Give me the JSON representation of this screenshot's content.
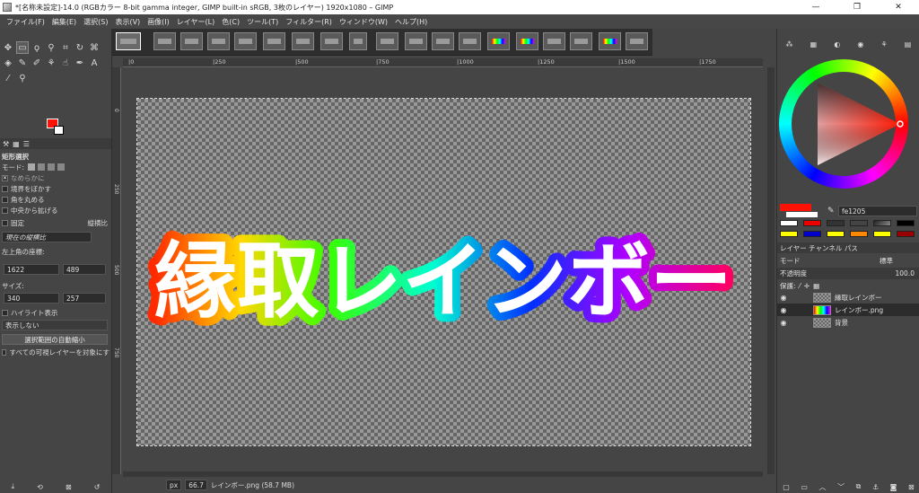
{
  "window": {
    "title": "*[名称未設定]-14.0 (RGBカラー 8-bit gamma integer, GIMP built-in sRGB, 3枚のレイヤー) 1920x1080 – GIMP",
    "minimize": "—",
    "maximize": "❐",
    "close": "✕"
  },
  "menu": [
    "ファイル(F)",
    "編集(E)",
    "選択(S)",
    "表示(V)",
    "画像(I)",
    "レイヤー(L)",
    "色(C)",
    "ツール(T)",
    "フィルター(R)",
    "ウィンドウ(W)",
    "ヘルプ(H)"
  ],
  "tool_options": {
    "title": "矩形選択",
    "mode_label": "モード:",
    "antialias": "なめらかに",
    "feather": "境界をぼかす",
    "rounded": "角を丸める",
    "expand_center": "中央から拡げる",
    "fixed": "固定",
    "aspect": "縦横比",
    "current_aspect": "現在の縦横比",
    "position_label": "左上角の座標:",
    "pos_x": "1622",
    "pos_y": "489",
    "unit": "px",
    "size_label": "サイズ:",
    "size_w": "340",
    "size_h": "257",
    "highlight": "ハイライト表示",
    "guides": "表示しない",
    "autoshrink": "選択範囲の自動縮小",
    "sample_merged": "すべての可視レイヤーを対象にす"
  },
  "ruler_h": [
    "|0",
    "|250",
    "|500",
    "|750",
    "|1000",
    "|1250",
    "|1500",
    "|1750"
  ],
  "ruler_v": [
    "0",
    "250",
    "500",
    "750"
  ],
  "canvas_text": "縁取レインボー",
  "status": {
    "unit": "px",
    "zoom": "66.7",
    "info": "レインボー.png (58.7 MB)"
  },
  "colors": {
    "foreground": "#fe1205",
    "hex": "fe1205"
  },
  "layers": {
    "tabs": "レイヤー  チャンネル  パス",
    "mode_label": "モード",
    "mode_value": "標準",
    "opacity_label": "不透明度",
    "opacity_value": "100.0",
    "lock_label": "保護:",
    "items": [
      {
        "name": "縁取レインボー"
      },
      {
        "name": "レインボー.png"
      },
      {
        "name": "背景"
      }
    ]
  }
}
